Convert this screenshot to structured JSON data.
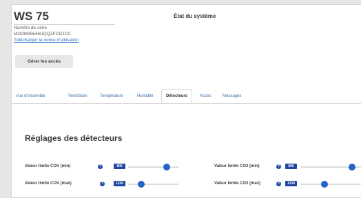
{
  "device": {
    "title": "WS 75",
    "serial_label": "Numéro de série",
    "serial_value": "M200895646UQQZFCD1C0",
    "manual_link": "Télécharger la notice d'utilisation",
    "access_button": "Gérer les accès"
  },
  "status_title": "État du système",
  "tabs": [
    {
      "label": "Vue d'ensemble",
      "active": false
    },
    {
      "label": "Ventilation",
      "active": false
    },
    {
      "label": "Température",
      "active": false
    },
    {
      "label": "Humidité",
      "active": false
    },
    {
      "label": "Détecteurs",
      "active": true
    },
    {
      "label": "Accès",
      "active": false
    },
    {
      "label": "Messages",
      "active": false
    }
  ],
  "section_title": "Réglages des détecteurs",
  "settings": [
    {
      "label": "Valeur limite COV (min)",
      "value": "800",
      "help_icon": "question-circle-icon",
      "slider_fraction": 0.75
    },
    {
      "label": "Valeur limite CO2 (min)",
      "value": "800",
      "help_icon": "question-circle-icon",
      "slider_fraction": 0.85
    },
    {
      "label": "Valeur limite COV (max)",
      "value": "1230",
      "help_icon": "question-circle-icon",
      "slider_fraction": 0.25
    },
    {
      "label": "Valeur limite CO2 (max)",
      "value": "1230",
      "help_icon": "question-circle-icon",
      "slider_fraction": 0.4
    }
  ],
  "colors": {
    "accent": "#1e46a0",
    "slider_thumb": "#2463c7",
    "link": "#2a6fc4"
  }
}
